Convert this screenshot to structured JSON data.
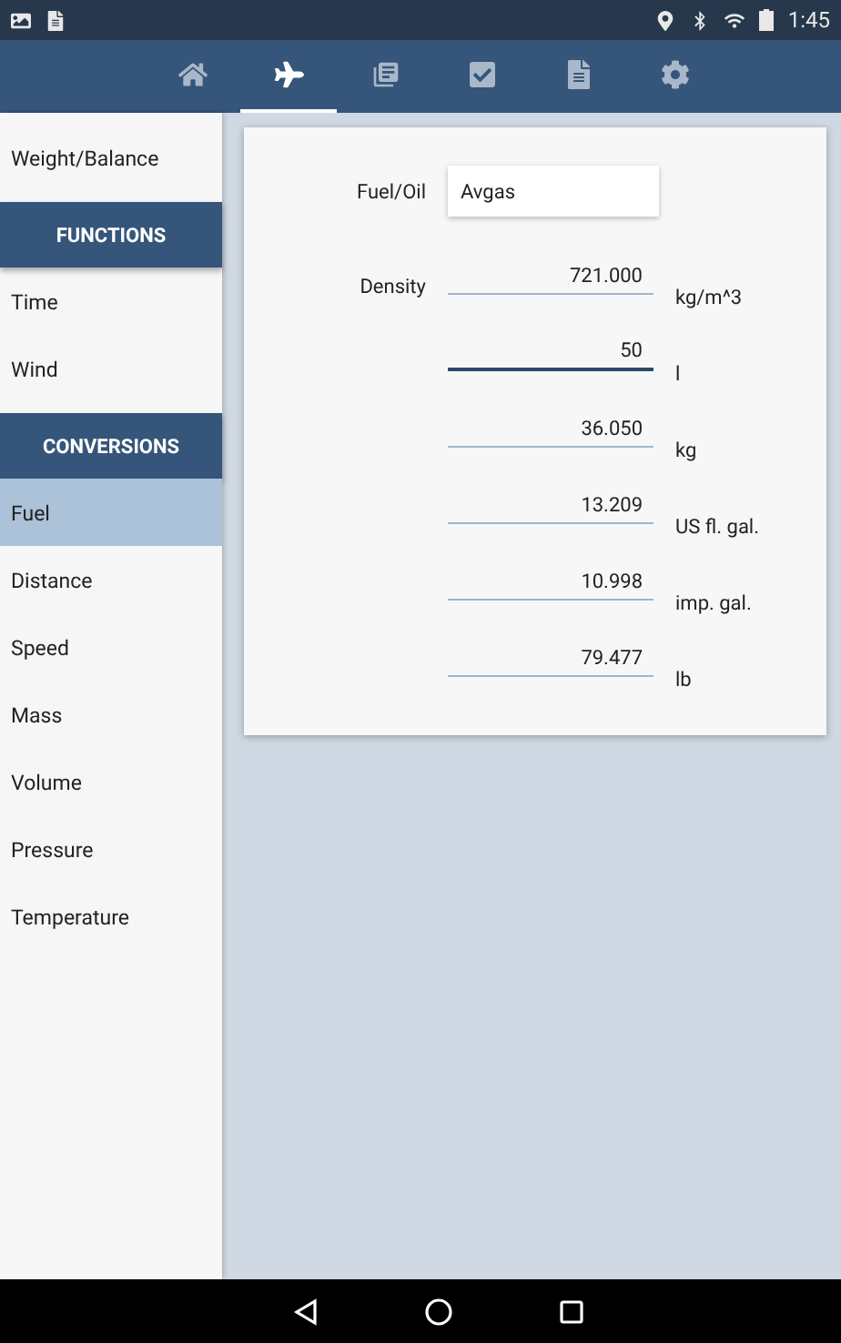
{
  "status_bar": {
    "time": "1:45"
  },
  "tabs": [
    {
      "kind": "home",
      "selected": false
    },
    {
      "kind": "plane",
      "selected": true
    },
    {
      "kind": "list",
      "selected": false
    },
    {
      "kind": "check",
      "selected": false
    },
    {
      "kind": "document",
      "selected": false
    },
    {
      "kind": "settings",
      "selected": false
    }
  ],
  "sidebar": {
    "items": [
      {
        "kind": "item",
        "label": "Weight/Balance",
        "selected": false
      },
      {
        "kind": "header",
        "label": "FUNCTIONS"
      },
      {
        "kind": "item",
        "label": "Time",
        "selected": false
      },
      {
        "kind": "item",
        "label": "Wind",
        "selected": false
      },
      {
        "kind": "header",
        "label": "CONVERSIONS"
      },
      {
        "kind": "item",
        "label": "Fuel",
        "selected": true
      },
      {
        "kind": "item",
        "label": "Distance",
        "selected": false
      },
      {
        "kind": "item",
        "label": "Speed",
        "selected": false
      },
      {
        "kind": "item",
        "label": "Mass",
        "selected": false
      },
      {
        "kind": "item",
        "label": "Volume",
        "selected": false
      },
      {
        "kind": "item",
        "label": "Pressure",
        "selected": false
      },
      {
        "kind": "item",
        "label": "Temperature",
        "selected": false
      }
    ]
  },
  "form": {
    "fuel_label": "Fuel/Oil",
    "fuel_value": "Avgas",
    "fields": [
      {
        "label": "Density",
        "value": "721.000",
        "unit": "kg/m^3",
        "focused": false
      },
      {
        "value": "50",
        "unit": "l",
        "focused": true
      },
      {
        "value": "36.050",
        "unit": "kg",
        "focused": false
      },
      {
        "value": "13.209",
        "unit": "US fl. gal.",
        "focused": false
      },
      {
        "value": "10.998",
        "unit": "imp. gal.",
        "focused": false
      },
      {
        "value": "79.477",
        "unit": "lb",
        "focused": false
      }
    ]
  }
}
